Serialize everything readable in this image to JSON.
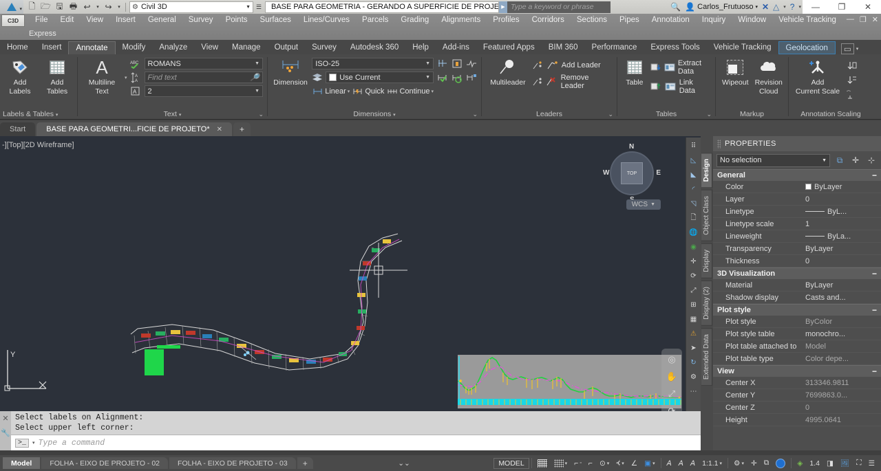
{
  "titlebar": {
    "quick_access": [
      "new-icon",
      "open-icon",
      "save-icon",
      "plot-icon",
      "undo-icon",
      "redo-icon"
    ],
    "workspace": "Civil 3D",
    "document_title": "BASE PARA GEOMETRIA - GERANDO A SUPERFICIE DE PROJE...",
    "search_placeholder": "Type a keyword or phrase",
    "user": "Carlos_Frutuoso",
    "window_buttons": [
      "minimize",
      "restore",
      "close"
    ]
  },
  "menubar": {
    "row1": [
      "File",
      "Edit",
      "View",
      "Insert",
      "General",
      "Survey",
      "Points",
      "Surfaces",
      "Lines/Curves",
      "Parcels",
      "Grading",
      "Alignments",
      "Profiles",
      "Corridors",
      "Sections",
      "Pipes",
      "Annotation",
      "Inquiry",
      "Window",
      "Vehicle Tracking"
    ],
    "row2": [
      "Express"
    ]
  },
  "ribbon_tabs": {
    "tabs": [
      "Home",
      "Insert",
      "Annotate",
      "Modify",
      "Analyze",
      "View",
      "Manage",
      "Output",
      "Survey",
      "Autodesk 360",
      "Help",
      "Add-ins",
      "Featured Apps",
      "BIM 360",
      "Performance",
      "Express Tools",
      "Vehicle Tracking",
      "Geolocation"
    ],
    "active": "Annotate",
    "boxed": "Geolocation"
  },
  "ribbon": {
    "panels": [
      {
        "title": "Labels & Tables",
        "buttons": [
          {
            "label_line1": "Add",
            "label_line2": "Labels",
            "icon": "tag-icon"
          },
          {
            "label_line1": "Add",
            "label_line2": "Tables",
            "icon": "table-icon"
          }
        ]
      },
      {
        "title": "Text",
        "big": {
          "label_line1": "Multiline",
          "label_line2": "Text",
          "icon": "text-A-icon"
        },
        "fields": [
          {
            "name": "text-style",
            "value": "ROMANS",
            "icon": "spellcheck-icon"
          },
          {
            "name": "find-text",
            "placeholder": "Find text",
            "icon": "find-replace-icon"
          },
          {
            "name": "annotation-scale",
            "value": "2",
            "icon": "text-scale-icon"
          }
        ]
      },
      {
        "title": "Dimensions",
        "big": {
          "label_line1": "Dimension",
          "label_line2": "",
          "icon": "dimension-icon"
        },
        "fields": [
          {
            "name": "dim-style",
            "value": "ISO-25"
          },
          {
            "name": "dim-layer",
            "value": "Use Current"
          }
        ],
        "row_buttons": [
          "Linear",
          "Quick",
          "Continue"
        ]
      },
      {
        "title": "Leaders",
        "big": {
          "label_line1": "Multileader",
          "label_line2": "",
          "icon": "multileader-icon"
        },
        "items": [
          "Add Leader",
          "Remove Leader"
        ]
      },
      {
        "title": "Tables",
        "big": {
          "label_line1": "Table",
          "label_line2": "",
          "icon": "table-icon"
        },
        "items": [
          "Extract Data",
          "Link Data"
        ]
      },
      {
        "title": "Markup",
        "buttons": [
          {
            "label_line1": "Wipeout",
            "label_line2": "",
            "icon": "wipeout-icon"
          },
          {
            "label_line1": "Revision",
            "label_line2": "Cloud",
            "icon": "revision-cloud-icon"
          }
        ]
      },
      {
        "title": "Annotation Scaling",
        "buttons": [
          {
            "label_line1": "Add",
            "label_line2": "Current Scale",
            "icon": "add-scale-icon"
          }
        ]
      }
    ]
  },
  "drawing_tabs": {
    "tabs": [
      {
        "label": "Start",
        "active": false,
        "closable": false
      },
      {
        "label": "BASE PARA GEOMETRI...FICIE DE PROJETO*",
        "active": true,
        "closable": true
      }
    ],
    "new_tab": "+"
  },
  "canvas": {
    "viewport_label": "-][Top][2D Wireframe]",
    "viewcube": {
      "top": "TOP",
      "n": "N",
      "s": "S",
      "e": "E",
      "w": "W"
    },
    "ucs_label": "WCS",
    "axis_y": "Y",
    "axis_x": "X"
  },
  "command_line": {
    "history": [
      "Select labels on Alignment:",
      "Select upper left corner:"
    ],
    "prompt_glyph": ">_",
    "placeholder": "Type a command"
  },
  "properties": {
    "header": "PROPERTIES",
    "selection": "No selection",
    "side_tabs": [
      "Design",
      "Object Class",
      "Display",
      "Display (2)",
      "Extended Data"
    ],
    "active_side_tab": "Design",
    "toolbar_icons": [
      "quick-select-icon",
      "select-objects-icon",
      "pickadd-icon"
    ],
    "groups": [
      {
        "name": "General",
        "collapse": "−",
        "rows": [
          {
            "key": "Color",
            "value": "ByLayer",
            "swatch": true
          },
          {
            "key": "Layer",
            "value": "0"
          },
          {
            "key": "Linetype",
            "value": "ByL...",
            "line": true
          },
          {
            "key": "Linetype scale",
            "value": "1"
          },
          {
            "key": "Lineweight",
            "value": "ByLa...",
            "line": true
          },
          {
            "key": "Transparency",
            "value": "ByLayer"
          },
          {
            "key": "Thickness",
            "value": "0"
          }
        ]
      },
      {
        "name": "3D Visualization",
        "collapse": "−",
        "rows": [
          {
            "key": "Material",
            "value": "ByLayer"
          },
          {
            "key": "Shadow display",
            "value": "Casts and..."
          }
        ]
      },
      {
        "name": "Plot style",
        "collapse": "−",
        "rows": [
          {
            "key": "Plot style",
            "value": "ByColor",
            "dim": true
          },
          {
            "key": "Plot style table",
            "value": "monochro..."
          },
          {
            "key": "Plot table attached to",
            "value": "Model",
            "dim": true
          },
          {
            "key": "Plot table type",
            "value": "Color depe...",
            "dim": true
          }
        ]
      },
      {
        "name": "View",
        "collapse": "−",
        "rows": [
          {
            "key": "Center X",
            "value": "313346.9811",
            "dim": true
          },
          {
            "key": "Center Y",
            "value": "7699863.0...",
            "dim": true
          },
          {
            "key": "Center Z",
            "value": "0",
            "dim": true
          },
          {
            "key": "Height",
            "value": "4995.0641",
            "dim": true
          }
        ]
      }
    ]
  },
  "statusbar": {
    "layout_tabs": [
      {
        "label": "Model",
        "active": true
      },
      {
        "label": "FOLHA - EIXO DE PROJETO - 02",
        "active": false
      },
      {
        "label": "FOLHA - EIXO DE PROJETO - 03",
        "active": false
      }
    ],
    "new_layout": "+",
    "overflow": "chevrons-icon",
    "space_toggle": "MODEL",
    "annotation_scale": "1:1.1",
    "lineweight_value": "1.4",
    "toggles": [
      "grid-display-icon",
      "snap-mode-icon",
      "infer-constraints-icon",
      "ortho-mode-icon",
      "polar-tracking-icon",
      "object-snap-icon",
      "object-snap-tracking-icon",
      "dynamic-ucs-icon",
      "selection-cycling-icon",
      "annotation-visibility-icon",
      "auto-scale-icon",
      "annotation-monitor-icon",
      "workspace-switching-icon",
      "hardware-acceleration-icon",
      "isolate-objects-icon",
      "clean-screen-icon",
      "customization-icon"
    ]
  }
}
